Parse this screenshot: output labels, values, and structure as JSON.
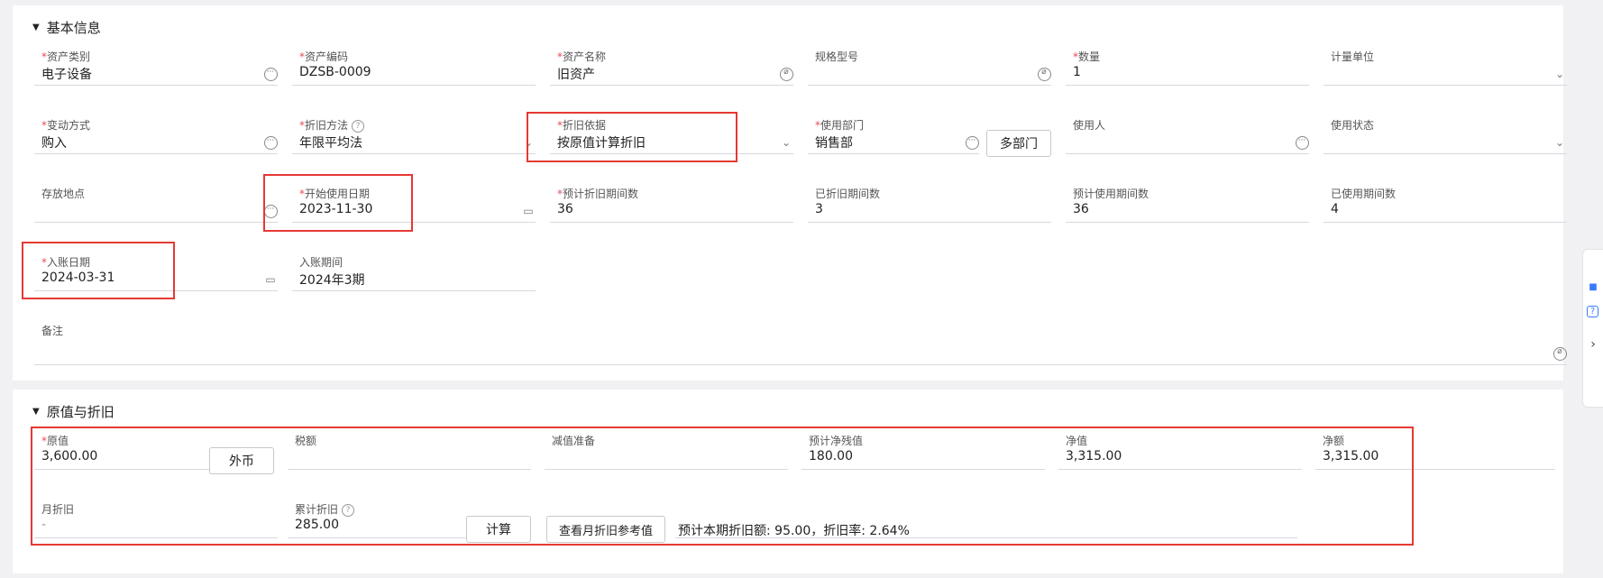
{
  "basic": {
    "title": "基本信息",
    "fields": {
      "asset_category": {
        "label": "资产类别",
        "value": "电子设备"
      },
      "asset_code": {
        "label": "资产编码",
        "value": "DZSB-0009"
      },
      "asset_name": {
        "label": "资产名称",
        "value": "旧资产"
      },
      "spec": {
        "label": "规格型号",
        "value": ""
      },
      "quantity": {
        "label": "数量",
        "value": "1"
      },
      "unit": {
        "label": "计量单位",
        "value": ""
      },
      "change_method": {
        "label": "变动方式",
        "value": "购入"
      },
      "depr_method": {
        "label": "折旧方法",
        "value": "年限平均法"
      },
      "depr_basis": {
        "label": "折旧依据",
        "value": "按原值计算折旧"
      },
      "dept": {
        "label": "使用部门",
        "value": "销售部"
      },
      "user": {
        "label": "使用人",
        "value": ""
      },
      "use_status": {
        "label": "使用状态",
        "value": ""
      },
      "location": {
        "label": "存放地点",
        "value": ""
      },
      "start_date": {
        "label": "开始使用日期",
        "value": "2023-11-30"
      },
      "est_periods": {
        "label": "预计折旧期间数",
        "value": "36"
      },
      "depr_periods": {
        "label": "已折旧期间数",
        "value": "3"
      },
      "est_use_periods": {
        "label": "预计使用期间数",
        "value": "36"
      },
      "used_periods": {
        "label": "已使用期间数",
        "value": "4"
      },
      "entry_date": {
        "label": "入账日期",
        "value": "2024-03-31"
      },
      "entry_period": {
        "label": "入账期间",
        "value": "2024年3期"
      },
      "remark": {
        "label": "备注",
        "value": ""
      }
    },
    "multi_dept_button": "多部门"
  },
  "value": {
    "title": "原值与折旧",
    "fields": {
      "original": {
        "label": "原值",
        "value": "3,600.00"
      },
      "tax": {
        "label": "税额",
        "value": ""
      },
      "impairment": {
        "label": "减值准备",
        "value": ""
      },
      "residual": {
        "label": "预计净残值",
        "value": "180.00"
      },
      "net_value": {
        "label": "净值",
        "value": "3,315.00"
      },
      "net_amount": {
        "label": "净额",
        "value": "3,315.00"
      },
      "monthly_depr": {
        "label": "月折旧",
        "value": "-"
      },
      "accum_depr": {
        "label": "累计折旧",
        "value": "285.00"
      }
    },
    "foreign_currency_button": "外币",
    "calc_button": "计算",
    "reference_button": "查看月折旧参考值",
    "estimate_text": "预计本期折旧额: 95.00，折旧率: 2.64%"
  },
  "required_mark": "*",
  "colors": {
    "highlight": "#e53935",
    "required": "#e34d59"
  }
}
